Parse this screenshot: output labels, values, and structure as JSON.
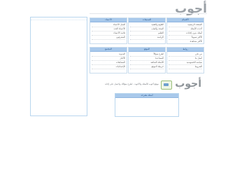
{
  "header": {
    "logo": "أجوب"
  },
  "cards": [
    {
      "title": "الأقسام",
      "links": [
        "الصفحة الرئيسية",
        "أحدث الأسئلة",
        "أسئلة بدون إجابات",
        "الأكثر تصويتاً",
        "الأكثر مشاهدة"
      ]
    },
    {
      "title": "التصنيفات",
      "links": [
        "العلوم والتقنية",
        "الصحة والطب",
        "التعليم",
        "الرياضة"
      ]
    },
    {
      "title": "الأعضاء",
      "links": [
        "أفضل الأعضاء",
        "الأعضاء الجدد",
        "قائمة الأعضاء",
        "المشرفون"
      ]
    },
    {
      "title": "روابط",
      "links": [
        "من نحن",
        "اتصل بنا",
        "سياسة الخصوصية",
        "الشروط"
      ]
    },
    {
      "title": "الموقع",
      "links": [
        "اطرح سؤالاً",
        "المساعدة",
        "الأسئلة الشائعة",
        "خريطة الموقع"
      ]
    },
    {
      "title": "المجتمع",
      "links": [
        "المدونة",
        "الأخبار",
        "المسابقات",
        "الإحصائيات"
      ]
    }
  ],
  "brand": {
    "logo": "أجوب",
    "tagline": "موقع أجوب للأسئلة والأجوبة - اطرح سؤالك واحصل على إجابة"
  },
  "bottom_panel": {
    "title": "أسئلة مقترحة"
  }
}
